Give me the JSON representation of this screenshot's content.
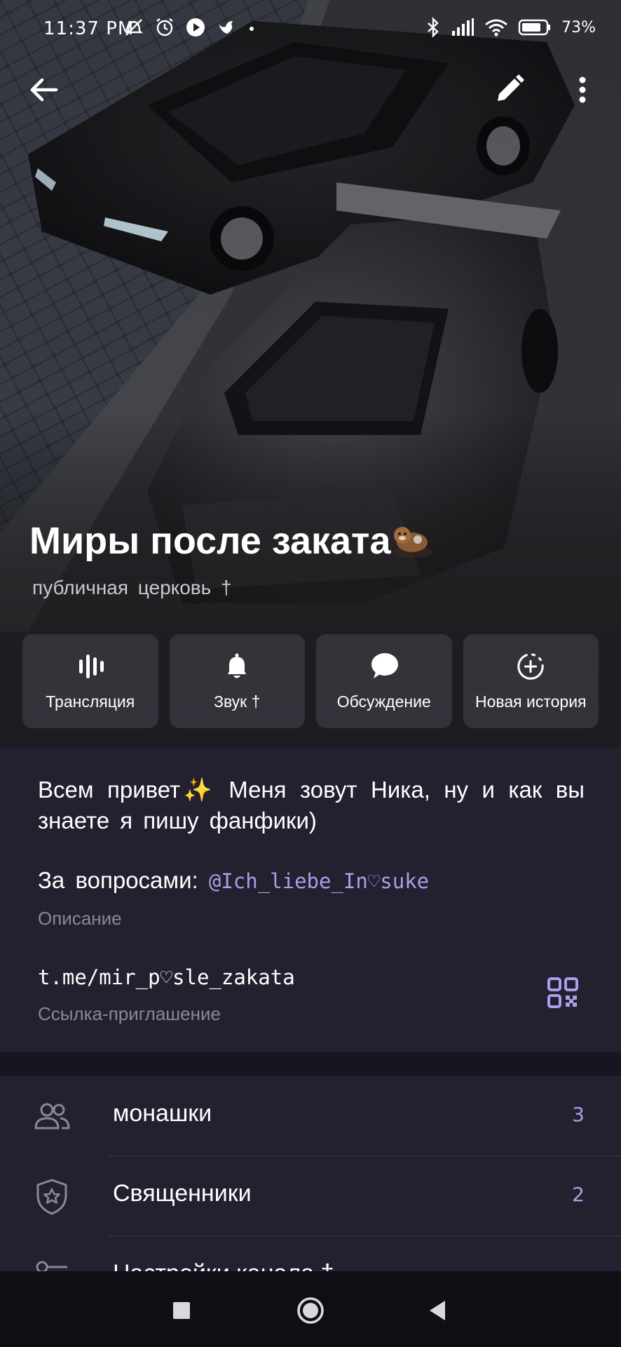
{
  "status_bar": {
    "time": "11:37 PM",
    "battery": "73%",
    "icons_left": [
      "do-not-disturb-icon",
      "alarm-icon",
      "play-icon",
      "bird-icon",
      "dot-icon"
    ],
    "icons_right": [
      "bluetooth-icon",
      "signal-icon",
      "wifi-icon",
      "battery-icon"
    ]
  },
  "header": {
    "back_icon": "arrow-left-icon",
    "edit_icon": "pencil-icon",
    "more_icon": "more-vertical-icon"
  },
  "channel": {
    "title": "Миры после заката",
    "title_emoji": "🦦",
    "subtitle": "публичная церковь †"
  },
  "actions": [
    {
      "label": "Трансляция",
      "icon": "live-stream-icon"
    },
    {
      "label": "Звук †",
      "icon": "bell-icon"
    },
    {
      "label": "Обсуждение",
      "icon": "chat-bubble-icon"
    },
    {
      "label": "Новая история",
      "icon": "story-add-icon"
    }
  ],
  "info": {
    "description": "Всем привет✨ Меня зовут Ника, ну и как вы знаете я пишу фанфики)",
    "questions_prefix": "За вопросами:",
    "questions_handle": "@Ich_liebe_In♡suke",
    "description_caption": "Описание",
    "invite_link": "t.me/mir_p♡sle_zakata",
    "invite_caption": "Ссылка-приглашение",
    "qr_icon": "qr-code-icon"
  },
  "list": [
    {
      "label": "монашки",
      "count": "3",
      "icon": "people-icon"
    },
    {
      "label": "Священники",
      "count": "2",
      "icon": "shield-star-icon"
    },
    {
      "label": "Настройки канала †",
      "count": "",
      "icon": "settings-key-icon"
    }
  ],
  "nav": [
    "recent-apps-icon",
    "home-icon",
    "back-triangle-icon"
  ],
  "colors": {
    "accent": "#a7a0ea",
    "panel": "#23202f",
    "muted": "#8a8799"
  }
}
